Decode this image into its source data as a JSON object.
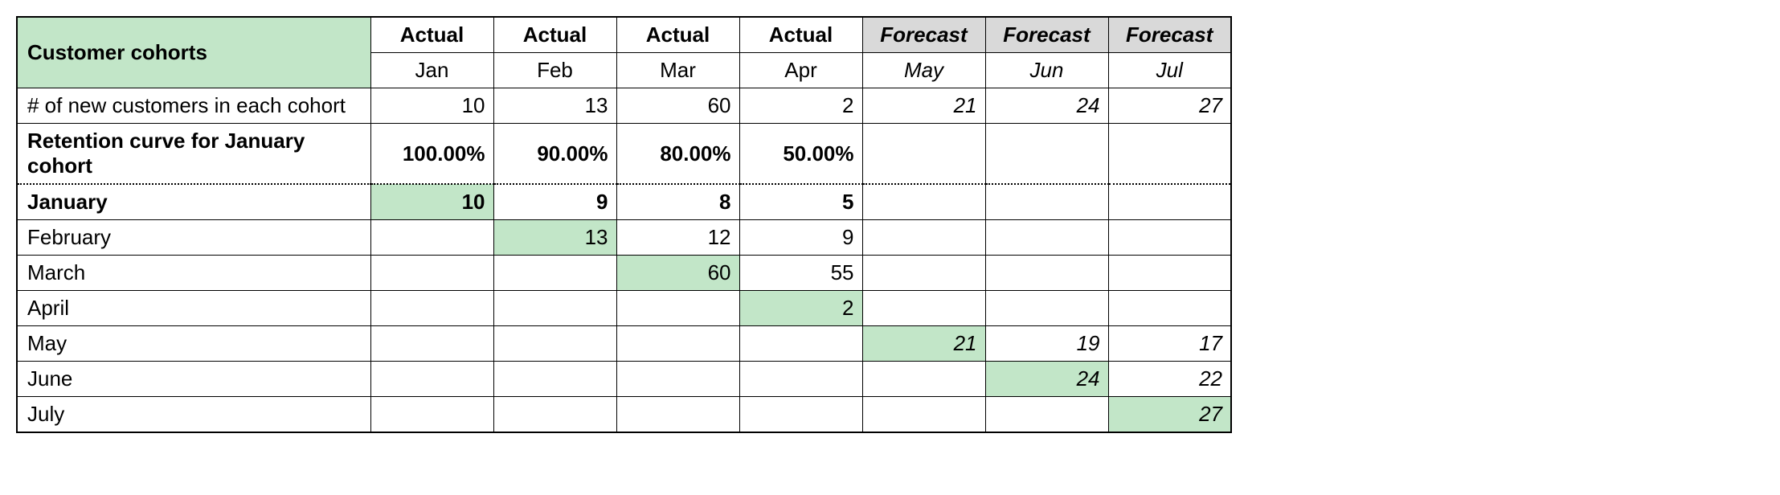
{
  "header": {
    "title": "Customer cohorts",
    "types": [
      "Actual",
      "Actual",
      "Actual",
      "Actual",
      "Forecast",
      "Forecast",
      "Forecast"
    ],
    "months": [
      "Jan",
      "Feb",
      "Mar",
      "Apr",
      "May",
      "Jun",
      "Jul"
    ],
    "forecast_start_index": 4
  },
  "rows": {
    "new_customers": {
      "label": "# of new customers in each cohort",
      "values": [
        "10",
        "13",
        "60",
        "2",
        "21",
        "24",
        "27"
      ]
    },
    "retention": {
      "label": "Retention curve for January cohort",
      "values": [
        "100.00%",
        "90.00%",
        "80.00%",
        "50.00%",
        "",
        "",
        ""
      ]
    },
    "cohorts": [
      {
        "label": "January",
        "values": [
          "10",
          "9",
          "8",
          "5",
          "",
          "",
          ""
        ],
        "diag": 0,
        "bold": true
      },
      {
        "label": "February",
        "values": [
          "",
          "13",
          "12",
          "9",
          "",
          "",
          ""
        ],
        "diag": 1,
        "bold": false
      },
      {
        "label": "March",
        "values": [
          "",
          "",
          "60",
          "55",
          "",
          "",
          ""
        ],
        "diag": 2,
        "bold": false
      },
      {
        "label": "April",
        "values": [
          "",
          "",
          "",
          "2",
          "",
          "",
          ""
        ],
        "diag": 3,
        "bold": false
      },
      {
        "label": "May",
        "values": [
          "",
          "",
          "",
          "",
          "21",
          "19",
          "17"
        ],
        "diag": 4,
        "bold": false
      },
      {
        "label": "June",
        "values": [
          "",
          "",
          "",
          "",
          "",
          "24",
          "22"
        ],
        "diag": 5,
        "bold": false
      },
      {
        "label": "July",
        "values": [
          "",
          "",
          "",
          "",
          "",
          "",
          "27"
        ],
        "diag": 6,
        "bold": false
      }
    ]
  },
  "chart_data": {
    "type": "table",
    "title": "Customer cohorts",
    "columns": [
      "Jan",
      "Feb",
      "Mar",
      "Apr",
      "May",
      "Jun",
      "Jul"
    ],
    "column_type": [
      "Actual",
      "Actual",
      "Actual",
      "Actual",
      "Forecast",
      "Forecast",
      "Forecast"
    ],
    "new_customers": [
      10,
      13,
      60,
      2,
      21,
      24,
      27
    ],
    "retention_curve_january": [
      1.0,
      0.9,
      0.8,
      0.5,
      null,
      null,
      null
    ],
    "cohort_matrix": {
      "January": [
        10,
        9,
        8,
        5,
        null,
        null,
        null
      ],
      "February": [
        null,
        13,
        12,
        9,
        null,
        null,
        null
      ],
      "March": [
        null,
        null,
        60,
        55,
        null,
        null,
        null
      ],
      "April": [
        null,
        null,
        null,
        2,
        null,
        null,
        null
      ],
      "May": [
        null,
        null,
        null,
        null,
        21,
        19,
        17
      ],
      "June": [
        null,
        null,
        null,
        null,
        null,
        24,
        22
      ],
      "July": [
        null,
        null,
        null,
        null,
        null,
        null,
        27
      ]
    }
  }
}
